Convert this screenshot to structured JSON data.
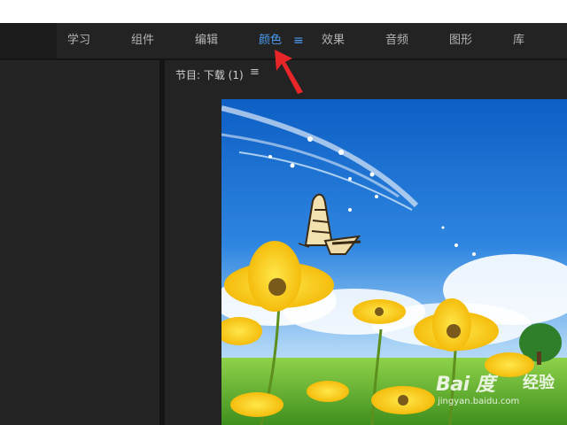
{
  "menubar": {
    "tabs": [
      {
        "label": "学习"
      },
      {
        "label": "组件"
      },
      {
        "label": "编辑"
      },
      {
        "label": "颜色"
      },
      {
        "label": "效果"
      },
      {
        "label": "音频"
      },
      {
        "label": "图形"
      },
      {
        "label": "库"
      }
    ],
    "active_tab": "颜色",
    "tab_menu_glyph": "≡"
  },
  "program_panel": {
    "title": "节目: 下载 (1)",
    "menu_glyph": "≡"
  },
  "watermark": {
    "logo": "Bai 度",
    "product": "经验",
    "url": "jingyan.baidu.com"
  },
  "colors": {
    "accent": "#4b9bf0",
    "annotation_arrow": "#e8262a"
  }
}
